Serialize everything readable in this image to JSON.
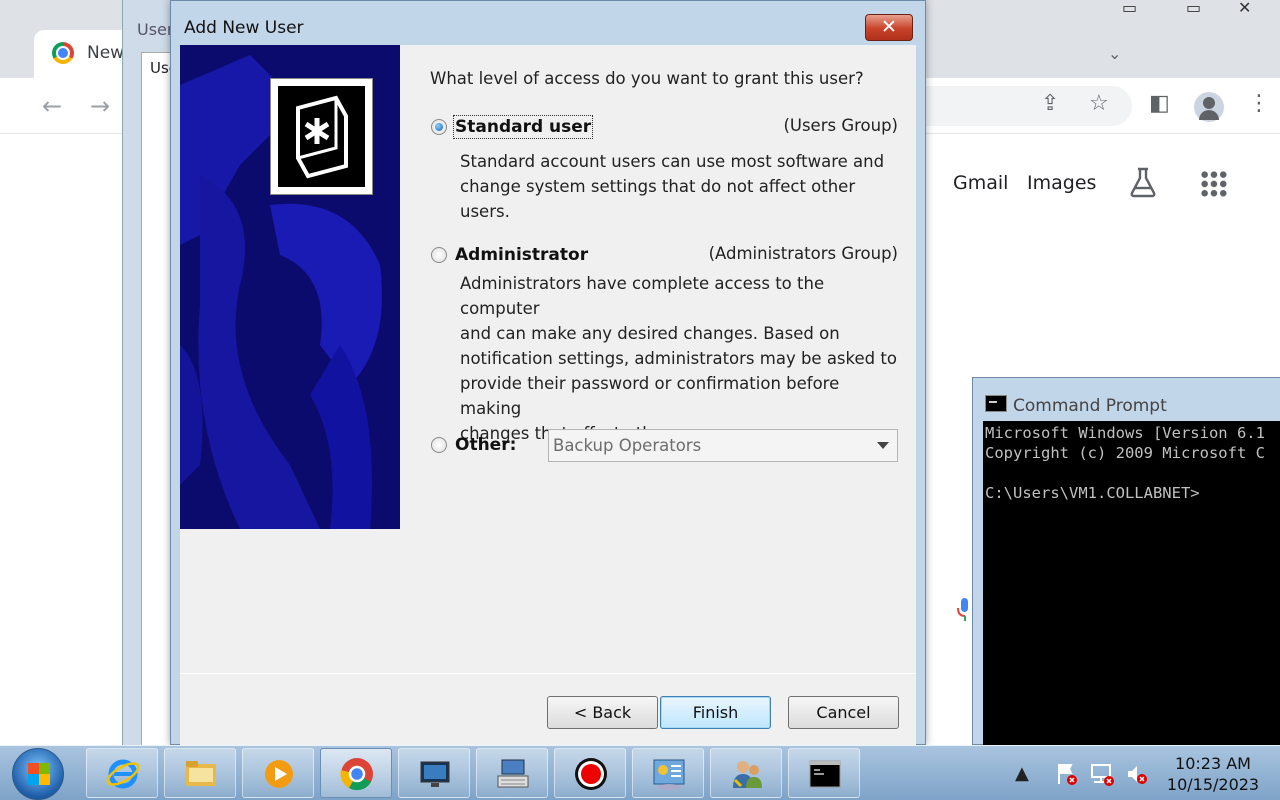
{
  "chrome": {
    "tab_title": "New",
    "nav_back": "←",
    "nav_forward": "→",
    "links": [
      "Gmail",
      "Images"
    ],
    "toolbar_icons": [
      "share-icon",
      "star-icon",
      "sidepanel-icon",
      "profile-icon",
      "menu-icon"
    ],
    "win_ctrls": [
      "—",
      "▭",
      "✕"
    ]
  },
  "mmc": {
    "title": "User",
    "inner_label": "Use"
  },
  "dialog": {
    "title": "Add New User",
    "close": "✕",
    "question": "What level of access do you want to grant this user?",
    "options": [
      {
        "label": "Standard user",
        "group": "(Users Group)",
        "checked": true,
        "description": [
          "Standard account users can use most software and",
          "change system settings that do not affect other users."
        ]
      },
      {
        "label": "Administrator",
        "group": "(Administrators Group)",
        "checked": false,
        "description": [
          "Administrators have complete access to the computer",
          "and can make any desired changes. Based on",
          "notification settings, administrators may be asked to",
          "provide their password or confirmation before making",
          "changes that affect other users."
        ]
      },
      {
        "label": "Other:",
        "checked": false,
        "select_value": "Backup Operators"
      }
    ],
    "buttons": {
      "back": "< Back",
      "finish": "Finish",
      "cancel": "Cancel"
    }
  },
  "cmd": {
    "title": "Command Prompt",
    "lines": [
      "Microsoft Windows [Version 6.1",
      "Copyright (c) 2009 Microsoft C",
      "",
      "C:\\Users\\VM1.COLLABNET>"
    ]
  },
  "taskbar": {
    "items": [
      "internet-explorer",
      "windows-explorer",
      "media-player",
      "chrome",
      "remote-desktop",
      "keyboard-settings",
      "recorder",
      "server-manager",
      "user-accounts",
      "command-prompt"
    ],
    "tray_icons": [
      "show-hidden-icons",
      "action-center-flag",
      "network",
      "volume-muted"
    ],
    "time": "10:23 AM",
    "date": "10/15/2023"
  }
}
